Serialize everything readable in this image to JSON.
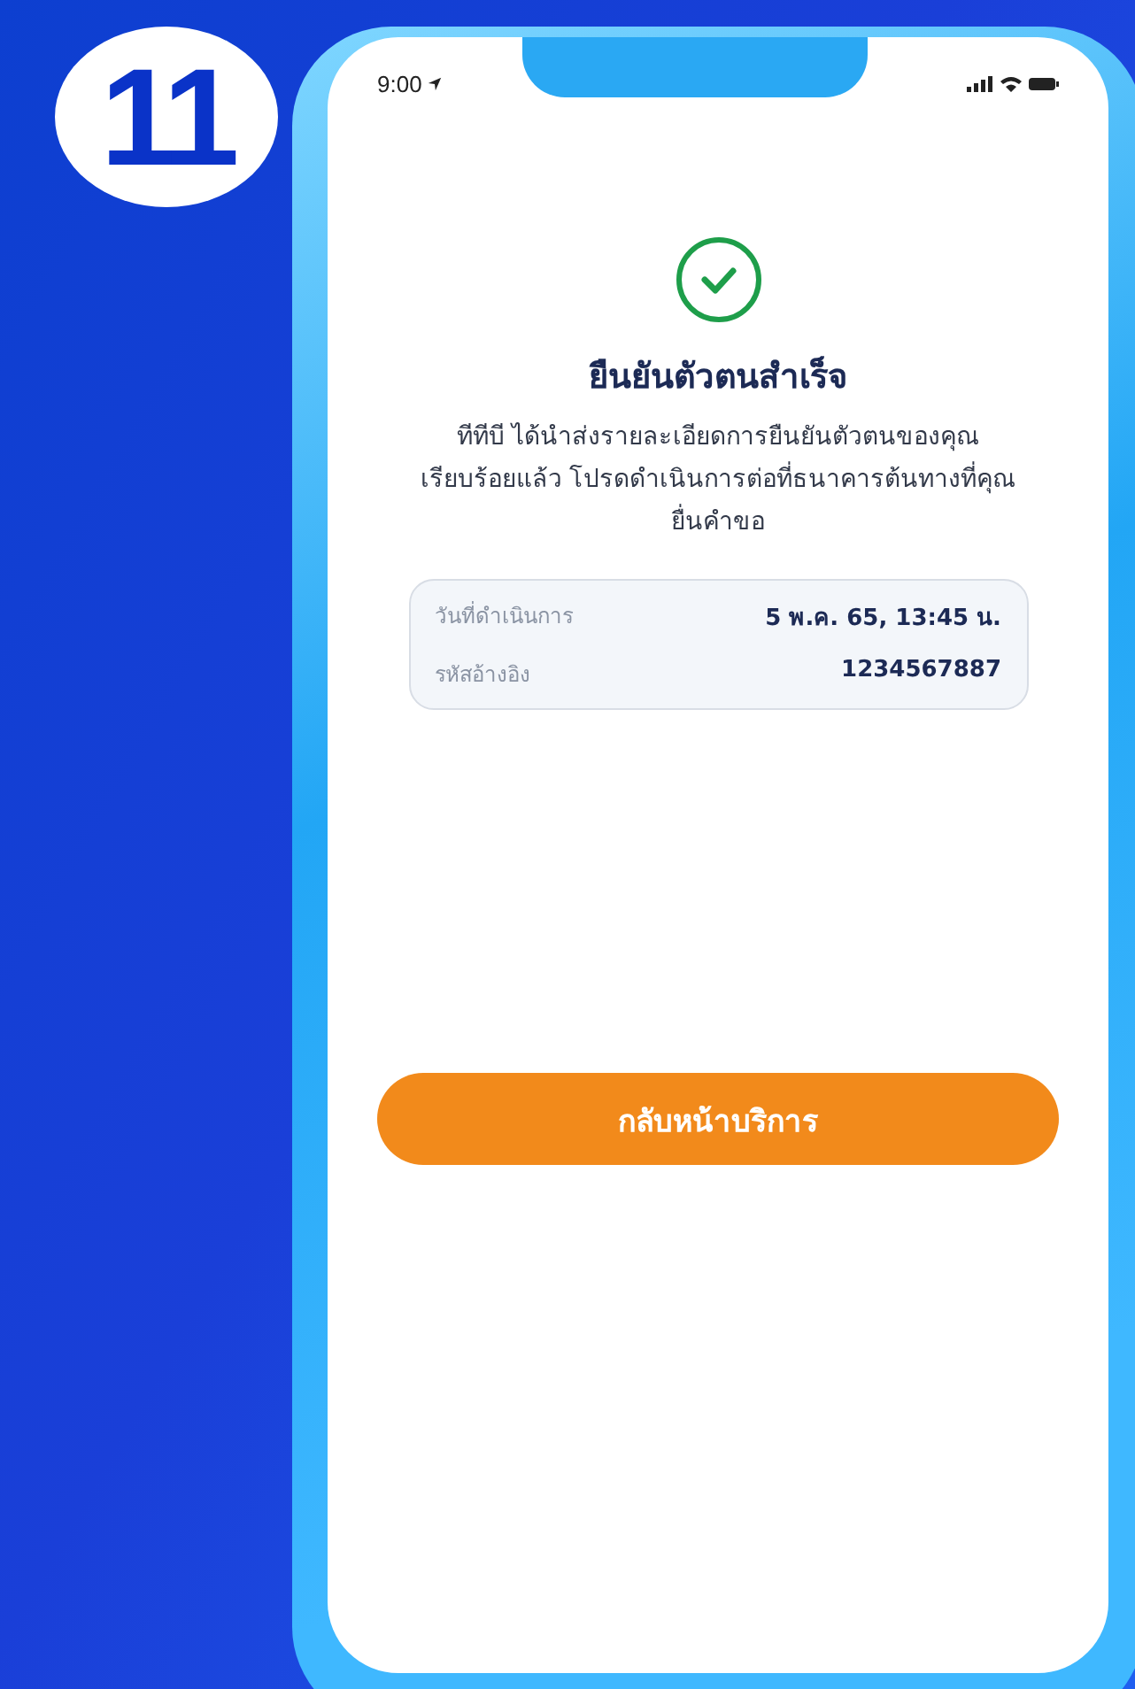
{
  "step_badge": "11",
  "status_bar": {
    "time": "9:00"
  },
  "title": "ยืนยันตัวตนสำเร็จ",
  "message": "ทีทีบี ได้นำส่งรายละเอียดการยืนยันตัวตนของคุณเรียบร้อยแล้ว โปรดดำเนินการต่อที่ธนาคารต้นทางที่คุณยื่นคำขอ",
  "details": [
    {
      "label": "วันที่ดำเนินการ",
      "value": "5 พ.ค. 65, 13:45 น."
    },
    {
      "label": "รหัสอ้างอิง",
      "value": "1234567887"
    }
  ],
  "button": "กลับหน้าบริการ"
}
